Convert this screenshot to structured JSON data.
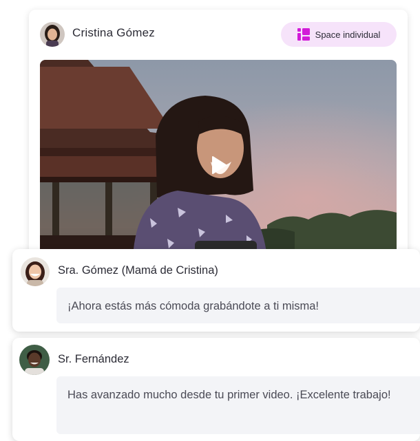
{
  "post": {
    "author_name": "Cristina Gómez",
    "space_badge_label": "Space individual",
    "video": {
      "play_icon": "play-icon"
    }
  },
  "comments": [
    {
      "author_name": "Sra. Gómez (Mamá de Cristina)",
      "text": "¡Ahora estás más cómoda grabándote a ti misma!"
    },
    {
      "author_name": "Sr. Fernández",
      "text": "Has avanzado mucho desde tu primer video. ¡Excelente trabajo!"
    }
  ],
  "colors": {
    "badge_background": "#f6e3fa",
    "badge_icon": "#d21bd8",
    "comment_bubble": "#f3f4f7",
    "text_primary": "#2b2b35"
  }
}
